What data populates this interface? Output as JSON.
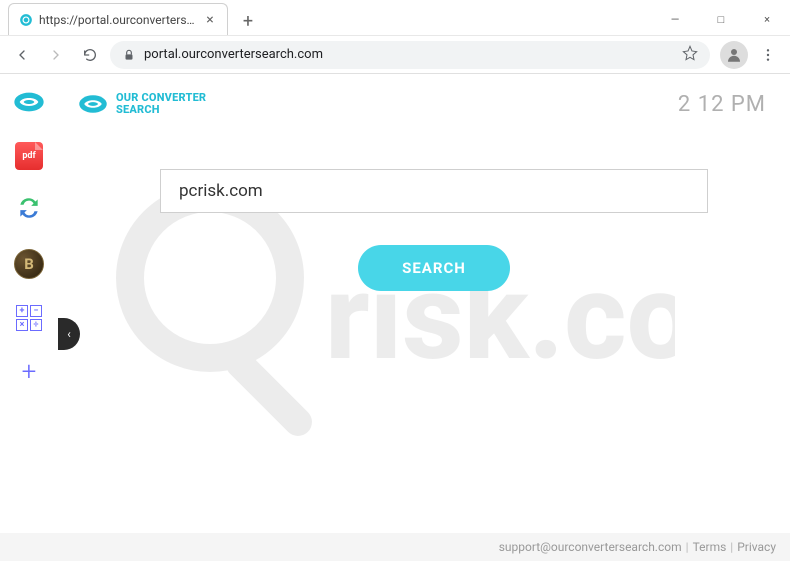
{
  "window": {
    "tab_title": "https://portal.ourconvertersearch",
    "url_display": "portal.ourconvertersearch.com",
    "new_tab_label": "+",
    "close_char": "×",
    "min_char": "—",
    "max_char": "□",
    "win_close_char": "×"
  },
  "brand": {
    "line1": "OUR CONVERTER",
    "line2": "SEARCH"
  },
  "clock": "2 12 PM",
  "search": {
    "value": "pcrisk.com",
    "button": "SEARCH"
  },
  "sidebar": {
    "pdf_label": "pdf",
    "coin_label": "B",
    "calc_cells": [
      "+",
      "−",
      "×",
      "÷"
    ],
    "add_label": "+",
    "collapse_char": "‹"
  },
  "footer": {
    "email": "support@ourconvertersearch.com",
    "terms": "Terms",
    "privacy": "Privacy"
  },
  "colors": {
    "accent": "#22bcd4",
    "search_btn": "#48d6e8"
  }
}
